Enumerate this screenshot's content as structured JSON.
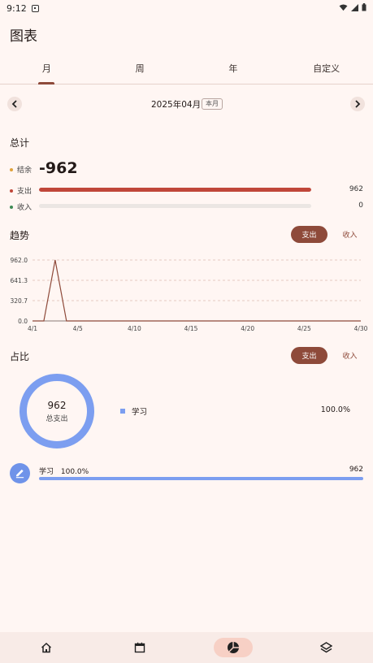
{
  "status_bar": {
    "time": "9:12"
  },
  "app": {
    "title": "图表"
  },
  "tabs": [
    {
      "label": "月"
    },
    {
      "label": "周"
    },
    {
      "label": "年"
    },
    {
      "label": "自定义"
    }
  ],
  "period": {
    "label": "2025年04月",
    "badge": "本月"
  },
  "summary": {
    "title": "总计",
    "balance_label": "结余",
    "balance_value": "-962",
    "expense_label": "支出",
    "expense_value": "962",
    "expense_fraction": 1.0,
    "income_label": "收入",
    "income_value": "0",
    "income_fraction": 0.0
  },
  "trend": {
    "title": "趋势",
    "toggle_expense": "支出",
    "toggle_income": "收入"
  },
  "chart_data": {
    "type": "line",
    "title": "",
    "xlabel": "",
    "ylabel": "",
    "y_ticks": [
      "962.0",
      "641.3",
      "320.7",
      "0.0"
    ],
    "x_ticks": [
      "4/1",
      "4/5",
      "4/10",
      "4/15",
      "4/20",
      "4/25",
      "4/30"
    ],
    "ylim": [
      0,
      962
    ],
    "grid": true,
    "x": [
      1,
      2,
      3,
      4,
      5,
      6,
      7,
      8,
      9,
      10,
      11,
      12,
      13,
      14,
      15,
      16,
      17,
      18,
      19,
      20,
      21,
      22,
      23,
      24,
      25,
      26,
      27,
      28,
      29,
      30
    ],
    "series": [
      {
        "values": [
          0,
          0,
          962,
          0,
          0,
          0,
          0,
          0,
          0,
          0,
          0,
          0,
          0,
          0,
          0,
          0,
          0,
          0,
          0,
          0,
          0,
          0,
          0,
          0,
          0,
          0,
          0,
          0,
          0,
          0
        ]
      }
    ]
  },
  "proportion": {
    "title": "占比",
    "toggle_expense": "支出",
    "toggle_income": "收入",
    "donut_total": "962",
    "donut_caption": "总支出",
    "legend": [
      {
        "label": "学习",
        "percent": "100.0%",
        "color": "#7c9ef0"
      }
    ]
  },
  "categories": [
    {
      "label": "学习",
      "percent": "100.0%",
      "value": "962",
      "fraction": 1.0,
      "icon": "pencil-icon"
    }
  ],
  "colors": {
    "accent": "#8e4a3a",
    "expense": "#c0473a",
    "income": "#3e8a55",
    "balance": "#e0a23a",
    "category": "#7c9ef0"
  },
  "bottom_nav": [
    {
      "icon": "home-icon"
    },
    {
      "icon": "calendar-icon"
    },
    {
      "icon": "pie-chart-icon",
      "active": true
    },
    {
      "icon": "layers-icon"
    }
  ]
}
